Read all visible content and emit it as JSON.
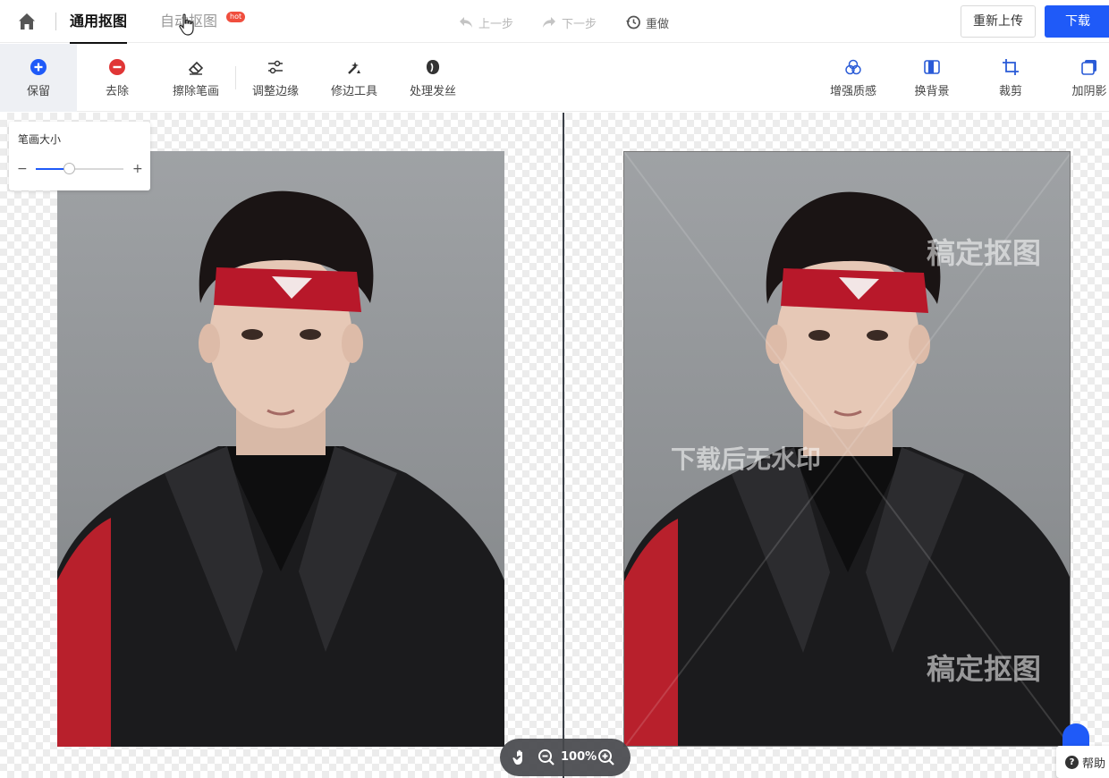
{
  "header": {
    "tabs": [
      {
        "label": "通用抠图",
        "active": true
      },
      {
        "label": "自动抠图",
        "active": false,
        "badge": "hot"
      }
    ],
    "history": {
      "undo": "上一步",
      "redo": "下一步",
      "redo_all": "重做"
    },
    "reupload_label": "重新上传",
    "download_label": "下载"
  },
  "toolbar": {
    "left_tools": [
      {
        "label": "保留",
        "icon": "plus-circle-icon",
        "selected": true
      },
      {
        "label": "去除",
        "icon": "minus-circle-icon",
        "selected": false
      },
      {
        "label": "擦除笔画",
        "icon": "eraser-icon",
        "selected": false
      },
      {
        "label": "调整边缘",
        "icon": "sliders-icon",
        "selected": false
      },
      {
        "label": "修边工具",
        "icon": "magic-brush-icon",
        "selected": false
      },
      {
        "label": "处理发丝",
        "icon": "hair-icon",
        "selected": false
      }
    ],
    "right_tools": [
      {
        "label": "增强质感",
        "icon": "enhance-icon"
      },
      {
        "label": "换背景",
        "icon": "background-icon"
      },
      {
        "label": "裁剪",
        "icon": "crop-icon"
      },
      {
        "label": "加阴影",
        "icon": "shadow-icon"
      }
    ]
  },
  "brush": {
    "title": "笔画大小",
    "minus": "−",
    "plus": "+",
    "level": 0.38
  },
  "watermarks": {
    "brand": "稿定抠图",
    "notice": "下载后无水印"
  },
  "zoom": {
    "level": "100%"
  },
  "help_label": "帮助",
  "colors": {
    "accent": "#1f5af8",
    "remove_red": "#e03636",
    "hot_badge": "#f04e3e"
  }
}
